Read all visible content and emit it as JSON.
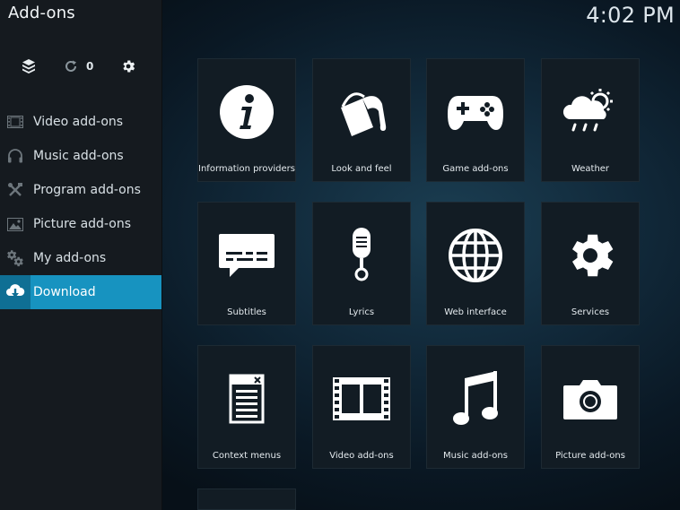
{
  "app": {
    "title": "Add-ons",
    "clock": "4:02 PM",
    "update_count": "0"
  },
  "toolbar": {
    "icons": [
      "install-from-zip-icon",
      "refresh-updates-icon",
      "settings-gear-icon"
    ]
  },
  "sidebar": {
    "items": [
      {
        "label": "Video add-ons",
        "icon": "film-icon",
        "active": false
      },
      {
        "label": "Music add-ons",
        "icon": "headphones-icon",
        "active": false
      },
      {
        "label": "Program add-ons",
        "icon": "tools-icon",
        "active": false
      },
      {
        "label": "Picture add-ons",
        "icon": "picture-icon",
        "active": false
      },
      {
        "label": "My add-ons",
        "icon": "gears-icon",
        "active": false
      },
      {
        "label": "Download",
        "icon": "cloud-download-icon",
        "active": true
      }
    ]
  },
  "grid": {
    "tiles": [
      {
        "label": "Information providers",
        "icon": "info-icon"
      },
      {
        "label": "Look and feel",
        "icon": "paint-bucket-icon"
      },
      {
        "label": "Game add-ons",
        "icon": "gamepad-icon"
      },
      {
        "label": "Weather",
        "icon": "weather-icon"
      },
      {
        "label": "Subtitles",
        "icon": "subtitles-icon"
      },
      {
        "label": "Lyrics",
        "icon": "microphone-icon"
      },
      {
        "label": "Web interface",
        "icon": "globe-icon"
      },
      {
        "label": "Services",
        "icon": "gear-icon"
      },
      {
        "label": "Context menus",
        "icon": "context-menu-icon"
      },
      {
        "label": "Video add-ons",
        "icon": "film-strip-icon"
      },
      {
        "label": "Music add-ons",
        "icon": "music-note-icon"
      },
      {
        "label": "Picture add-ons",
        "icon": "camera-icon"
      }
    ]
  },
  "colors": {
    "accent": "#1793c0",
    "sidebar_bg": "#151a1f",
    "tile_bg": "#121c24"
  }
}
